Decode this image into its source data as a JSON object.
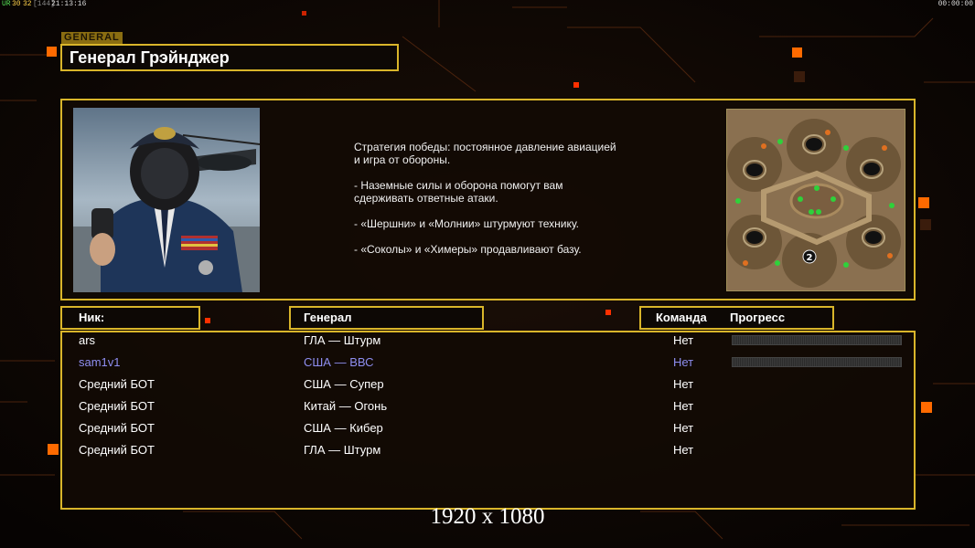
{
  "topbar": {
    "left_fps": "UR",
    "left_a": "30",
    "left_b": "32",
    "left_c": "[144]",
    "left_time": "21:13:16",
    "right_time": "00:00:00"
  },
  "general": {
    "tag": "GENERAL",
    "name": "Генерал Грэйнджер"
  },
  "description": "Стратегия победы: постоянное давление авиацией\n и игра от обороны.\n\n- Наземные силы и оборона помогут вам\n сдерживать ответные атаки.\n\n- «Шершни» и «Молнии» штурмуют технику.\n\n- «Соколы» и «Химеры» продавливают базу.",
  "headers": {
    "nick": "Ник:",
    "general": "Генерал",
    "team": "Команда",
    "progress": "Прогресс"
  },
  "players": [
    {
      "nick": "ars",
      "general": "ГЛА — Штурм",
      "team": "Нет",
      "color": "#ffffff",
      "progress_bar": true
    },
    {
      "nick": "sam1v1",
      "general": "США — ВВС",
      "team": "Нет",
      "color": "#8e8ef0",
      "progress_bar": true
    },
    {
      "nick": "Средний БОТ",
      "general": "США — Супер",
      "team": "Нет",
      "color": "#ffffff",
      "progress_bar": false
    },
    {
      "nick": "Средний БОТ",
      "general": "Китай — Огонь",
      "team": "Нет",
      "color": "#ffffff",
      "progress_bar": false
    },
    {
      "nick": "Средний БОТ",
      "general": "США — Кибер",
      "team": "Нет",
      "color": "#ffffff",
      "progress_bar": false
    },
    {
      "nick": "Средний БОТ",
      "general": "ГЛА — Штурм",
      "team": "Нет",
      "color": "#ffffff",
      "progress_bar": false
    }
  ],
  "minimap": {
    "player_marker": "2"
  },
  "resolution_label": "1920 x 1080",
  "colors": {
    "accent": "#d9b52a",
    "orange": "#ff6a00"
  }
}
